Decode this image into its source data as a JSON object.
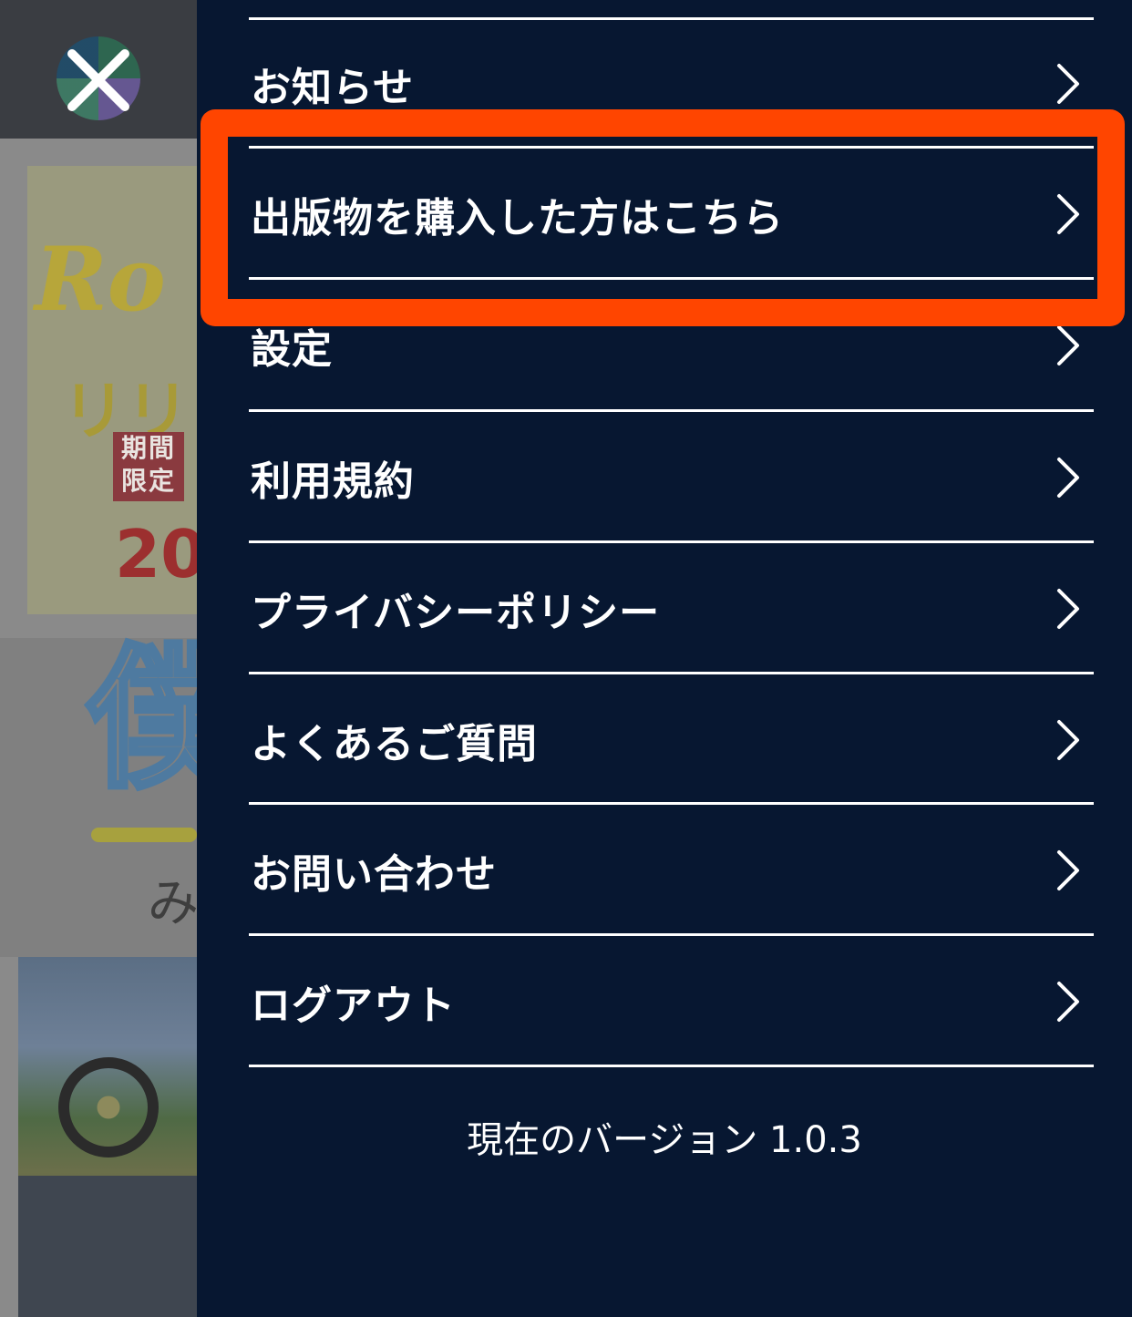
{
  "background": {
    "banner": {
      "title_fragment": "Ro",
      "subtitle_fragment": "リリ",
      "badge": "期間限定",
      "number_fragment": "20"
    },
    "section_kanji": "僕",
    "section_sub": "み"
  },
  "menu": {
    "items": [
      {
        "label": "お知らせ"
      },
      {
        "label": "出版物を購入した方はこちら"
      },
      {
        "label": "設定"
      },
      {
        "label": "利用規約"
      },
      {
        "label": "プライバシーポリシー"
      },
      {
        "label": "よくあるご質問"
      },
      {
        "label": "お問い合わせ"
      },
      {
        "label": "ログアウト"
      }
    ],
    "version_text": "現在のバージョン 1.0.3",
    "highlighted_item": "出版物を購入した方はこちら"
  },
  "colors": {
    "drawer_bg": "#071731",
    "highlight": "#ff4500",
    "text": "#ffffff"
  },
  "icons": {
    "close": "close-icon",
    "chevron": "chevron-right-icon"
  }
}
